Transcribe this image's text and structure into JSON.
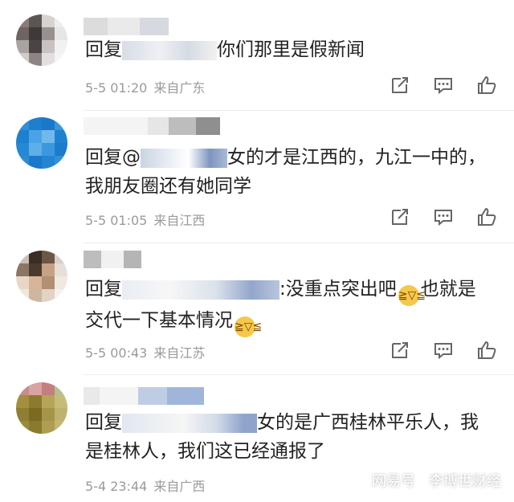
{
  "comments": [
    {
      "reply_prefix": "回复",
      "text_after": "你们那里是假新闻",
      "line2": "",
      "date": "5-5 01:20",
      "location": "来自广东"
    },
    {
      "reply_prefix": "回复@",
      "text_after": "女的才是江西的，九江一中的，",
      "line2": "我朋友圈还有她同学",
      "date": "5-5 01:05",
      "location": "来自江西"
    },
    {
      "reply_prefix": "回复",
      "text_after": ":没重点突出吧",
      "text_after2": "也就是",
      "line2": "交代一下基本情况",
      "date": "5-5 00:43",
      "location": "来自江苏"
    },
    {
      "reply_prefix": "回复",
      "text_after": "女的是广西桂林平乐人，我",
      "line2": "是桂林人，我们这已经通报了",
      "date": "5-4 23:44",
      "location": "来自广西"
    }
  ],
  "watermark": {
    "brand": "网易号",
    "author": "李博世财经"
  },
  "icons": {
    "share": "share-icon",
    "comment": "comment-icon",
    "like": "like-icon"
  }
}
